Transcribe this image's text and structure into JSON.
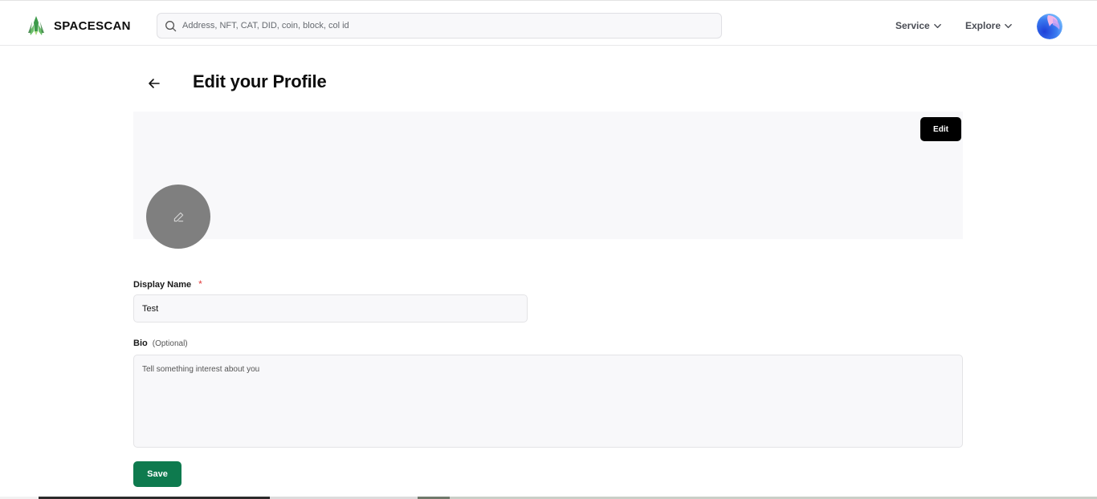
{
  "brand": {
    "name": "SPACESCAN"
  },
  "search": {
    "placeholder": "Address, NFT, CAT, DID, coin, block, col id"
  },
  "nav": {
    "items": [
      {
        "label": "Service",
        "icon": "chevron-down-icon"
      },
      {
        "label": "Explore",
        "icon": "chevron-down-icon"
      }
    ]
  },
  "page": {
    "title": "Edit your Profile"
  },
  "banner": {
    "edit_label": "Edit"
  },
  "form": {
    "display_name": {
      "label": "Display Name",
      "required_mark": "*",
      "value": "Test"
    },
    "bio": {
      "label": "Bio",
      "optional_note": "(Optional)",
      "placeholder": "Tell something interest about you",
      "value": ""
    },
    "save_label": "Save"
  },
  "colors": {
    "save_button": "#0e7a4e",
    "edit_button": "#000000",
    "required_mark": "#e23b3b",
    "banner_bg": "#f8f8fa",
    "avatar_placeholder": "#7f7f7f"
  }
}
